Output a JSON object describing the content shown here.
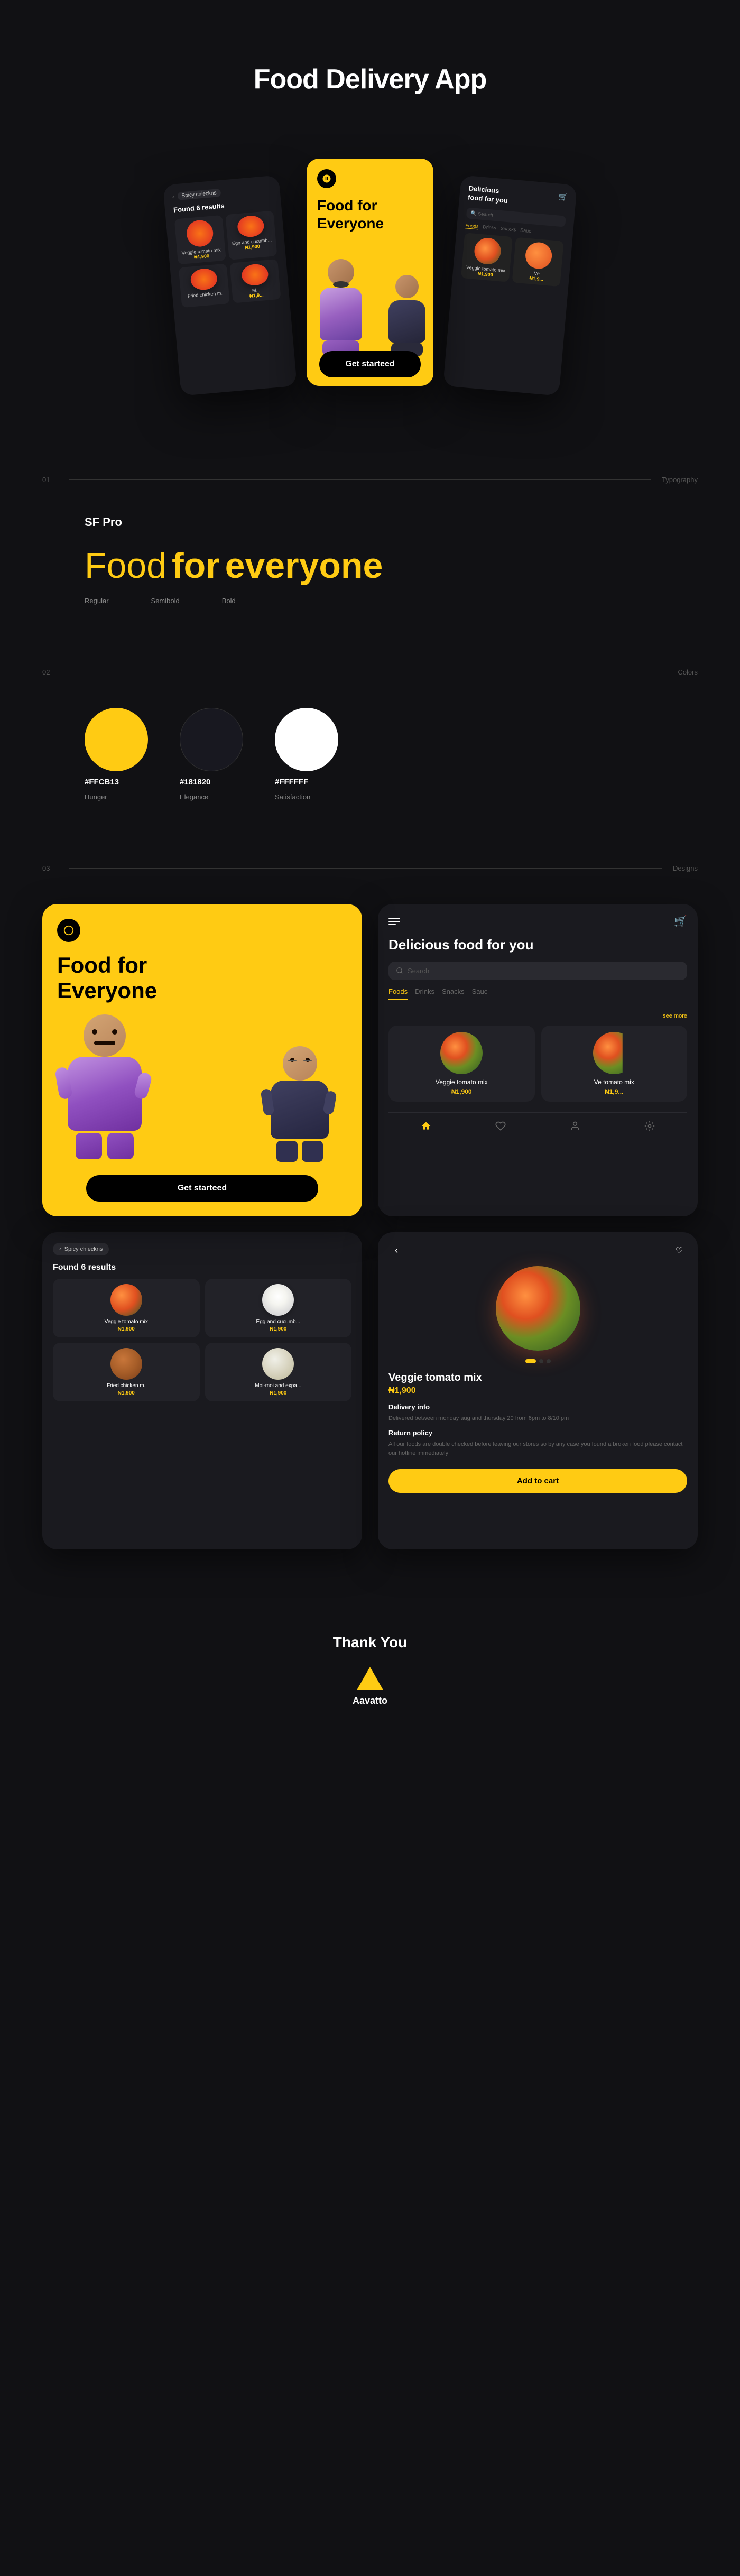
{
  "page": {
    "title": "Food Delivery App"
  },
  "header": {
    "title": "Food Delivery App"
  },
  "section01": {
    "number": "01",
    "label": "Typography"
  },
  "typography": {
    "font_name": "SF Pro",
    "sample_word1": "Food",
    "sample_word2": "for",
    "sample_word3": "everyone",
    "label_regular": "Regular",
    "label_semibold": "Semibold",
    "label_bold": "Bold"
  },
  "section02": {
    "number": "02",
    "label": "Colors"
  },
  "colors": {
    "color1": {
      "hex": "#FFCB13",
      "name": "Hunger",
      "value": "#FFCB13"
    },
    "color2": {
      "hex": "#181820",
      "name": "Elegance",
      "value": "#181820"
    },
    "color3": {
      "hex": "#FFFFFF",
      "name": "Satisfaction",
      "value": "#FFFFFF"
    }
  },
  "section03": {
    "number": "03",
    "label": "Designs"
  },
  "app": {
    "onboarding": {
      "icon_label": "chef-hat",
      "title_line1": "Food for",
      "title_line2": "Everyone",
      "cta_button": "Get starteed"
    },
    "home": {
      "greeting": "Delicious food for you",
      "search_placeholder": "Search",
      "categories": [
        "Foods",
        "Drinks",
        "Snacks",
        "Sauc"
      ],
      "active_category": "Foods",
      "see_more_label": "see more",
      "cart_label": "cart icon",
      "hamburger_label": "menu"
    },
    "search": {
      "back_label": "Spicy chieckns",
      "results_label": "Found 6 results",
      "items": [
        {
          "name": "Veggie tomato mix",
          "price": "₦1,900"
        },
        {
          "name": "Egg and cucumber...",
          "price": "₦1,900"
        },
        {
          "name": "Fried chicken m.",
          "price": "₦1,900"
        },
        {
          "name": "Moi-moi and expa...",
          "price": "₦1,900"
        }
      ]
    },
    "detail": {
      "product_name": "Veggie tomato mix",
      "price": "₦1,900",
      "delivery_title": "Delivery info",
      "delivery_text": "Delivered between monday aug and thursday 20 from 6pm to 8/10 pm",
      "return_title": "Return policy",
      "return_text": "All our foods are double checked before leaving our stores so by any case you found a broken food please contact our hotline immediately",
      "add_to_cart_button": "Add to cart"
    },
    "food_items": [
      {
        "name": "Veggie tomato mix",
        "price": "₦1,900"
      },
      {
        "name": "Ve",
        "price": "₦1,9..."
      }
    ]
  },
  "thank_you": {
    "title": "Thank You",
    "logo_name": "Aavatto"
  }
}
